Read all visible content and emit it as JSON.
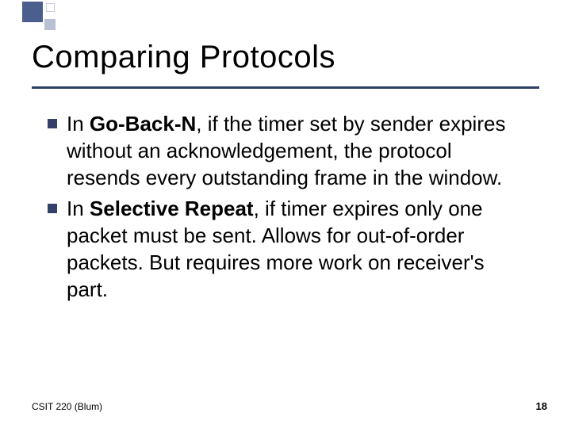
{
  "title": "Comparing Protocols",
  "bullets": [
    {
      "prefix": "In ",
      "bold": "Go-Back-N",
      "rest": ", if the timer set by sender expires without an acknowledgement, the protocol resends every outstanding frame in the window."
    },
    {
      "prefix": "In ",
      "bold": "Selective Repeat",
      "rest": ", if timer expires only one packet must be sent. Allows for out-of-order packets. But requires more work on receiver's part."
    }
  ],
  "footer": {
    "left": "CSIT 220 (Blum)",
    "right": "18"
  }
}
